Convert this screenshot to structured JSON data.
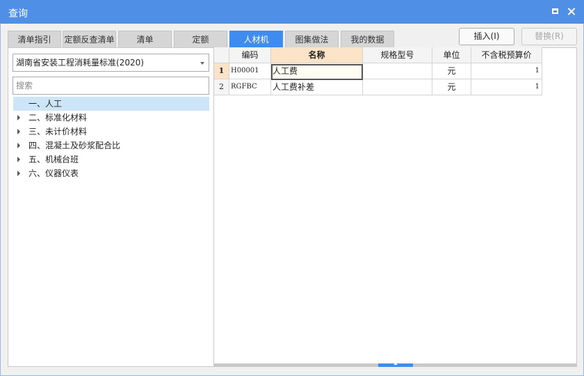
{
  "window": {
    "title": "查询"
  },
  "tabs": [
    {
      "label": "清单指引"
    },
    {
      "label": "定额反查清单"
    },
    {
      "label": "清单"
    },
    {
      "label": "定额"
    },
    {
      "label": "人材机"
    },
    {
      "label": "图集做法"
    },
    {
      "label": "我的数据"
    }
  ],
  "active_tab": "人材机",
  "buttons": {
    "insert_label": "插入(I)",
    "replace_label": "替换(R)"
  },
  "left_panel": {
    "standard_select": "湖南省安装工程消耗量标准(2020)",
    "search_placeholder": "搜索",
    "tree": [
      {
        "label": "一、人工",
        "expandable": false,
        "selected": true
      },
      {
        "label": "二、标准化材料",
        "expandable": true,
        "selected": false
      },
      {
        "label": "三、未计价材料",
        "expandable": true,
        "selected": false
      },
      {
        "label": "四、混凝土及砂浆配合比",
        "expandable": true,
        "selected": false
      },
      {
        "label": "五、机械台班",
        "expandable": true,
        "selected": false
      },
      {
        "label": "六、仪器仪表",
        "expandable": true,
        "selected": false
      }
    ]
  },
  "table": {
    "columns": [
      "编码",
      "名称",
      "规格型号",
      "单位",
      "不含税预算价"
    ],
    "rows": [
      {
        "index": "1",
        "code": "H00001",
        "name": "人工费",
        "spec": "",
        "unit": "元",
        "price": "1"
      },
      {
        "index": "2",
        "code": "RGFBC",
        "name": "人工费补差",
        "spec": "",
        "unit": "元",
        "price": "1"
      }
    ]
  },
  "colors": {
    "titlebar": "#4f8fe6",
    "active_tab": "#3f8cf0",
    "selected_header": "#fbe3c8",
    "tree_selected": "#cde6f7"
  },
  "icons": {
    "maximize": "maximize-icon",
    "close": "close-icon",
    "dropdown": "chevron-down-icon",
    "tree_expand": "chevron-right-icon"
  }
}
